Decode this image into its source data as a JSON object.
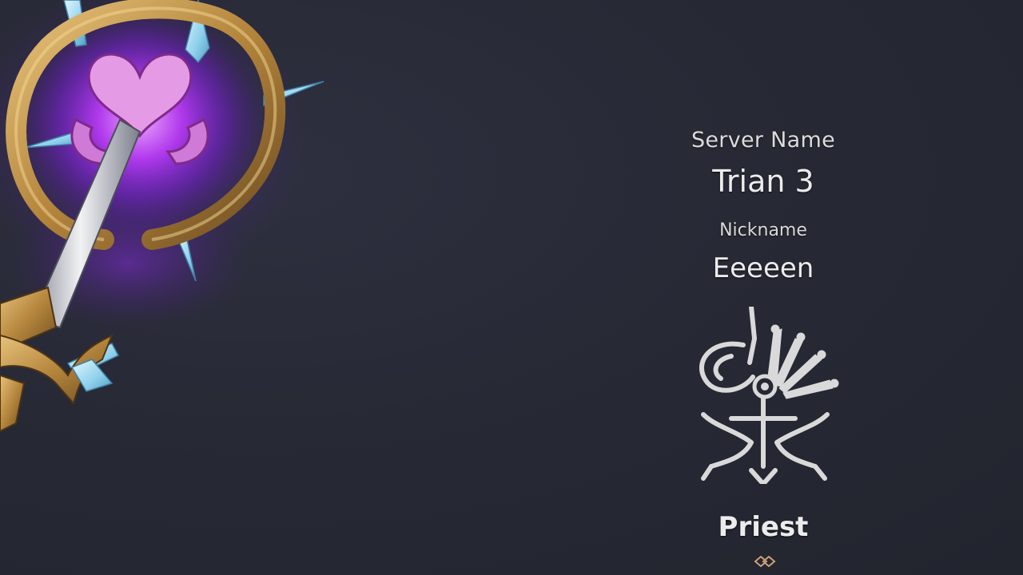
{
  "profile": {
    "server_label": "Server Name",
    "server_value": "Trian 3",
    "nickname_label": "Nickname",
    "nickname_value": "Eeeeen",
    "class_name": "Priest"
  },
  "icons": {
    "weapon_art": "priest-staff-icon",
    "class_emblem": "priest-class-emblem-icon",
    "divider_ornament": "diamond-ornament-icon"
  },
  "colors": {
    "background": "#262833",
    "text": "#ececec",
    "gold": "#c79a4a",
    "crystal": "#9fd8ef",
    "arcane_glow": "#b030ff",
    "divider": "#b08a68"
  }
}
